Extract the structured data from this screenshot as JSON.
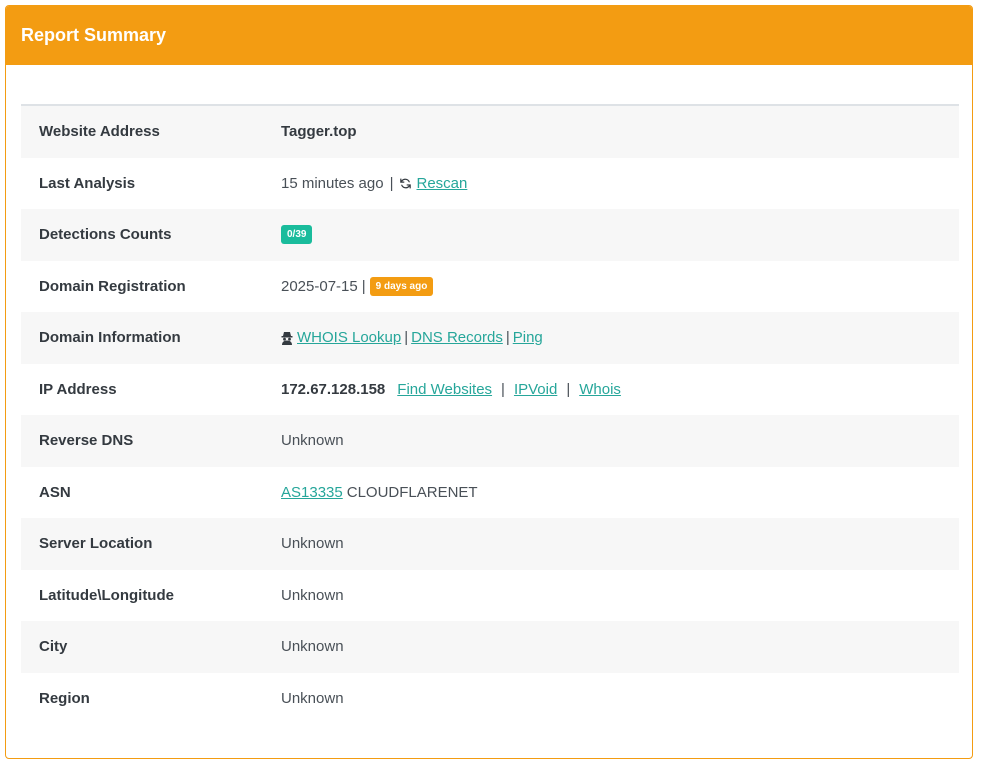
{
  "header": {
    "title": "Report Summary"
  },
  "colors": {
    "accent": "#f39c12",
    "badge_green": "#1abc9c",
    "link": "#26a69a"
  },
  "rows": {
    "website": {
      "label": "Website Address",
      "value": "Tagger.top"
    },
    "last_analysis": {
      "label": "Last Analysis",
      "value": "15 minutes ago",
      "separator": "|",
      "rescan": "Rescan",
      "icon": "refresh-icon"
    },
    "detections": {
      "label": "Detections Counts",
      "badge": "0/39"
    },
    "registration": {
      "label": "Domain Registration",
      "date": "2025-07-15",
      "separator": "|",
      "badge": "9 days ago"
    },
    "domain_info": {
      "label": "Domain Information",
      "icon": "spy-icon",
      "whois": "WHOIS Lookup",
      "sep1": "|",
      "dns": "DNS Records",
      "sep2": "|",
      "ping": "Ping"
    },
    "ip": {
      "label": "IP Address",
      "value": "172.67.128.158",
      "find": "Find Websites",
      "sep1": "|",
      "ipvoid": "IPVoid",
      "sep2": "|",
      "whois": "Whois"
    },
    "reverse_dns": {
      "label": "Reverse DNS",
      "value": "Unknown"
    },
    "asn": {
      "label": "ASN",
      "link": "AS13335",
      "value": "CLOUDFLARENET"
    },
    "server_location": {
      "label": "Server Location",
      "value": "Unknown"
    },
    "latlong": {
      "label": "Latitude\\Longitude",
      "value": "Unknown"
    },
    "city": {
      "label": "City",
      "value": "Unknown"
    },
    "region": {
      "label": "Region",
      "value": "Unknown"
    }
  }
}
